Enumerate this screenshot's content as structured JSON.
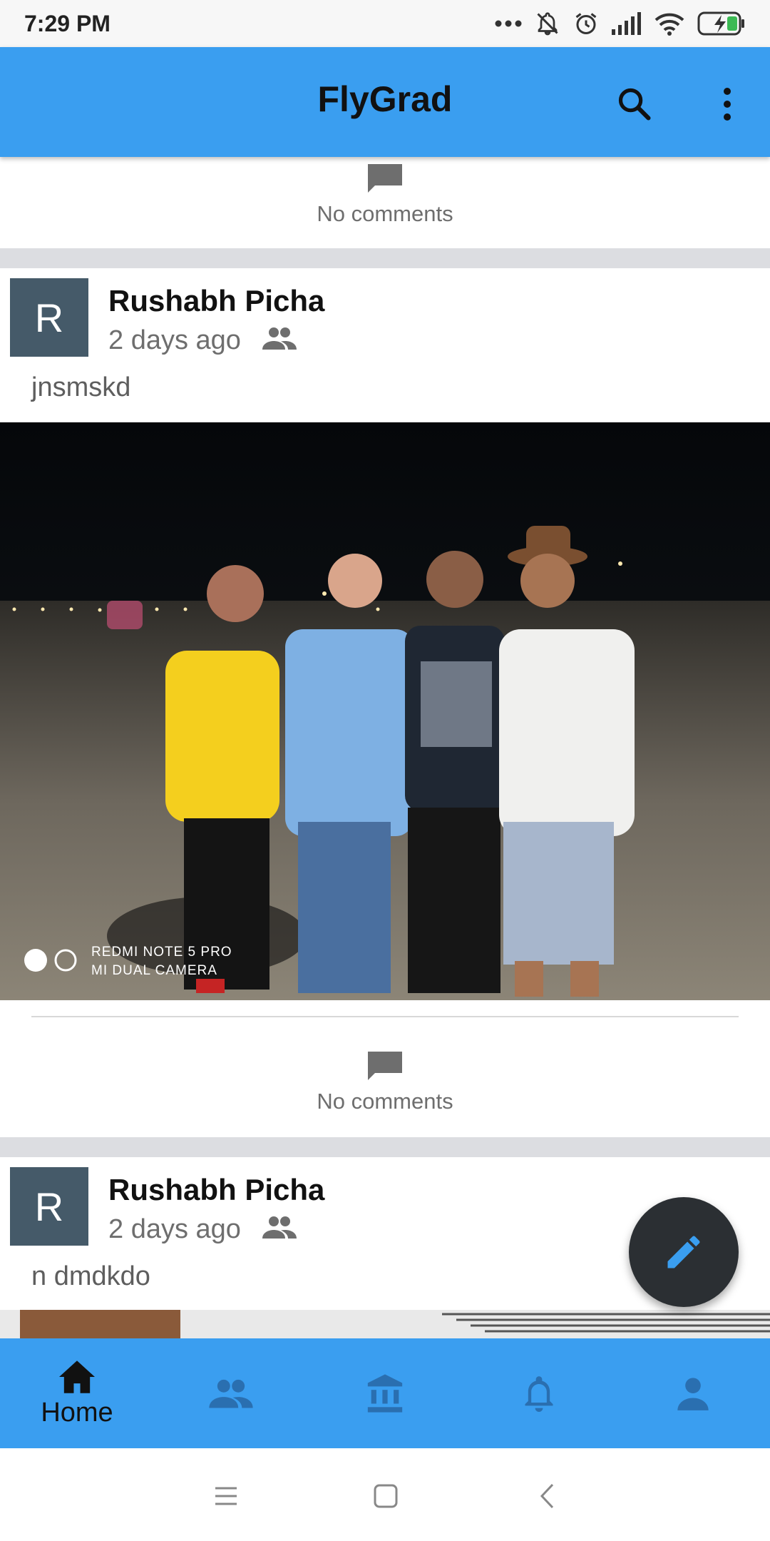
{
  "status_bar": {
    "time": "7:29 PM"
  },
  "app_bar": {
    "title": "FlyGrad"
  },
  "feed": {
    "top_comments": "No comments",
    "posts": [
      {
        "avatar_letter": "R",
        "author": "Rushabh Picha",
        "time": "2 days ago",
        "text": "jnsmskd",
        "image_watermark_line1": "REDMI NOTE 5 PRO",
        "image_watermark_line2": "MI DUAL CAMERA",
        "comments": "No comments"
      },
      {
        "avatar_letter": "R",
        "author": "Rushabh Picha",
        "time": "2 days ago",
        "text": "n dmdkdo"
      }
    ]
  },
  "bottom_nav": {
    "home_label": "Home"
  },
  "colors": {
    "app_bar": "#3a9ef0",
    "fab": "#2b2f33",
    "avatar": "#455a69",
    "separator": "#dcdde1"
  }
}
